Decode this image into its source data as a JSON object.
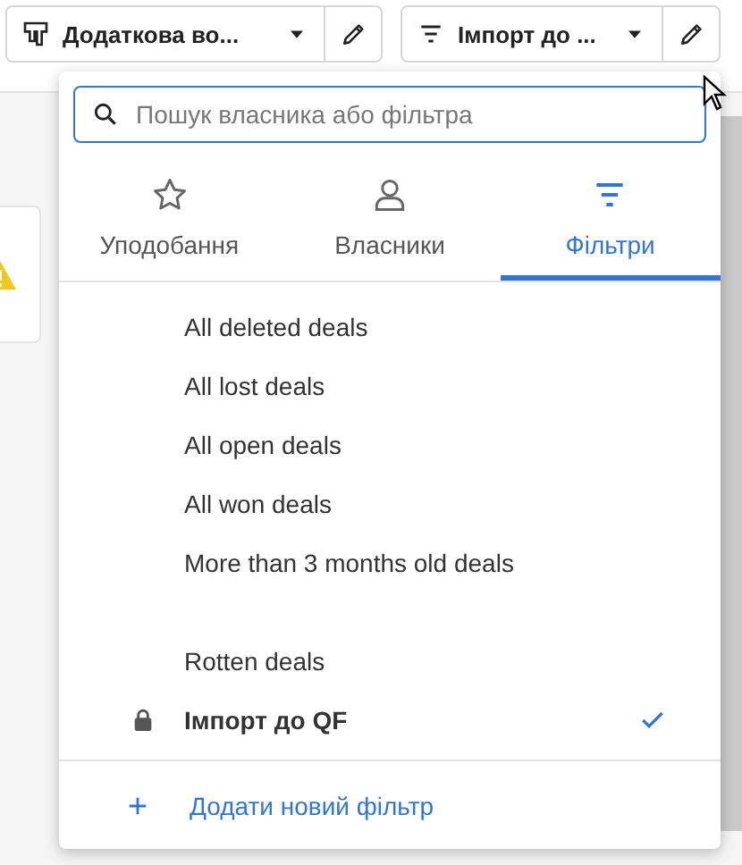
{
  "toolbar": {
    "pipeline_select": {
      "label": "Додаткова во..."
    },
    "filter_select": {
      "label": "Імпорт до ..."
    }
  },
  "filter_menu": {
    "search": {
      "placeholder": "Пошук власника або фільтра"
    },
    "tabs": [
      {
        "label": "Уподобання",
        "kind": "star",
        "selected": false
      },
      {
        "label": "Власники",
        "kind": "person",
        "selected": false
      },
      {
        "label": "Фільтри",
        "kind": "filter",
        "selected": true
      }
    ],
    "groups": [
      {
        "items": [
          {
            "label": "All deleted deals",
            "locked": false,
            "selected": false
          },
          {
            "label": "All lost deals",
            "locked": false,
            "selected": false
          },
          {
            "label": "All open deals",
            "locked": false,
            "selected": false
          },
          {
            "label": "All won deals",
            "locked": false,
            "selected": false
          },
          {
            "label": "More than 3 months old deals",
            "locked": false,
            "selected": false
          }
        ]
      },
      {
        "items": [
          {
            "label": "Rotten deals",
            "locked": false,
            "selected": false
          },
          {
            "label": "Імпорт до QF",
            "locked": true,
            "selected": true
          }
        ]
      }
    ],
    "add_filter": {
      "label": "Додати новий фільтр"
    }
  }
}
